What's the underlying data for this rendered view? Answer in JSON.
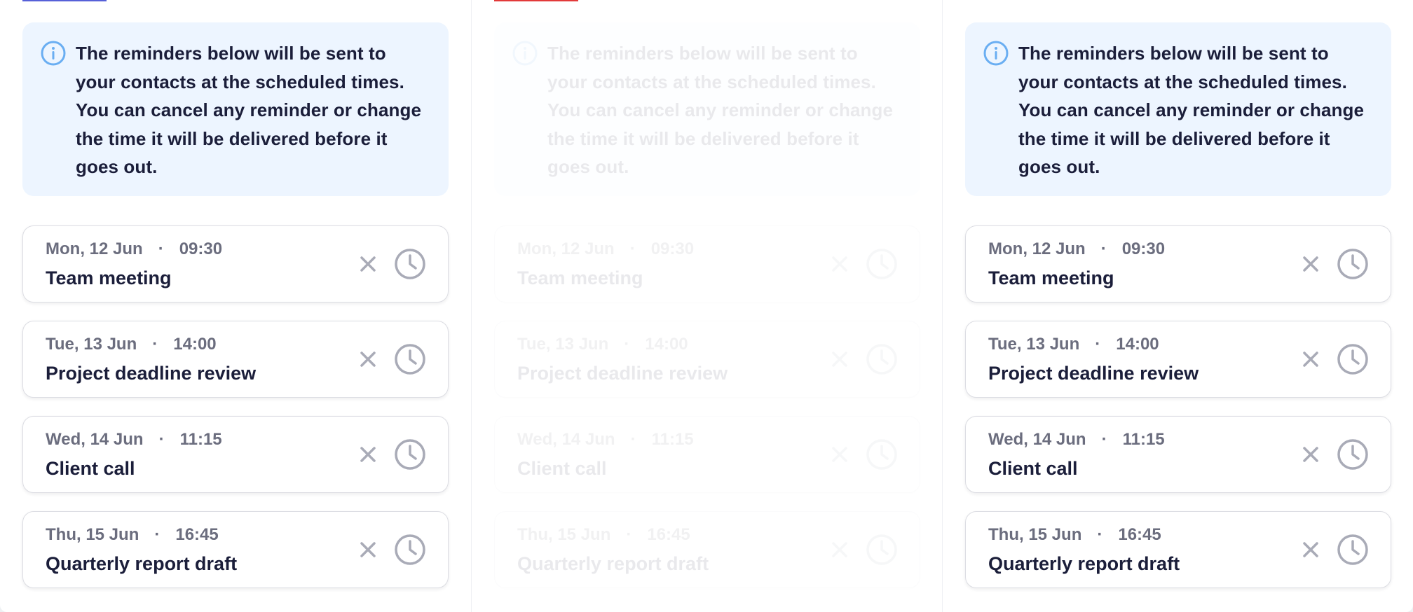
{
  "colors": {
    "info_background": "#edf5ff",
    "info_icon": "#6aaef2",
    "title_text": "#1b1e3a",
    "meta_text": "#6b6d7e",
    "action_icon": "#a9abb7",
    "tab_indicator_1": "#5660d8",
    "tab_indicator_2": "#e23a3a"
  },
  "info": {
    "icon": "info-circle-icon",
    "text": "The reminders below will be sent to your contacts at the scheduled times. You can cancel any reminder or change the time it will be delivered before it goes out."
  },
  "reminders": [
    {
      "date": "Mon, 12 Jun",
      "time": "09:30",
      "title": "Team meeting",
      "meta_sep": "·"
    },
    {
      "date": "Tue, 13 Jun",
      "time": "14:00",
      "title": "Project deadline review",
      "meta_sep": "·"
    },
    {
      "date": "Wed, 14 Jun",
      "time": "11:15",
      "title": "Client call",
      "meta_sep": "·"
    },
    {
      "date": "Thu, 15 Jun",
      "time": "16:45",
      "title": "Quarterly report draft",
      "meta_sep": "·"
    }
  ],
  "icons": {
    "dismiss": "close-icon",
    "reschedule": "clock-icon"
  }
}
